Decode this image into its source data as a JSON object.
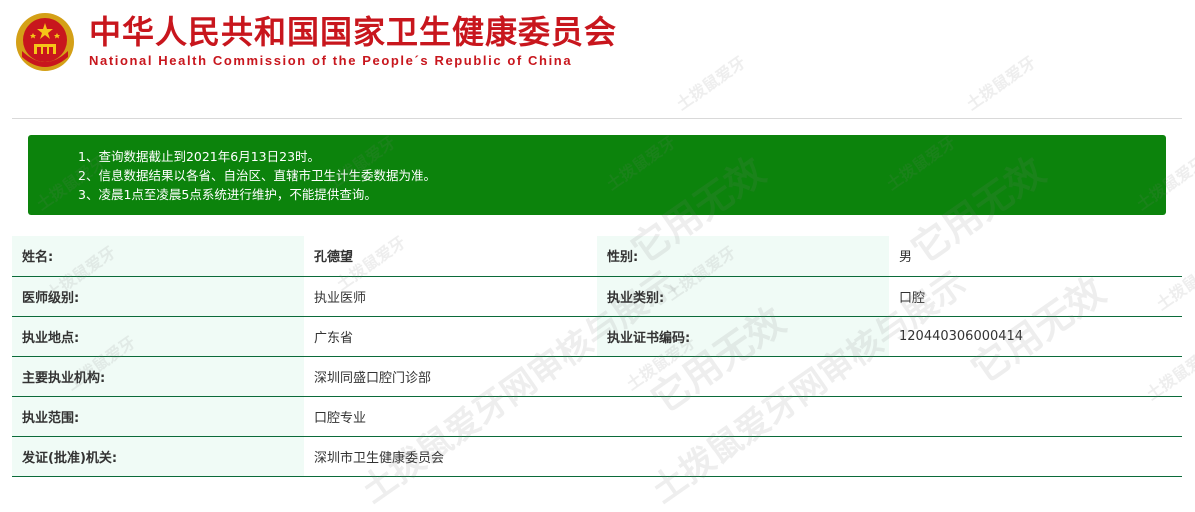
{
  "header": {
    "title_cn": "中华人民共和国国家卫生健康委员会",
    "title_en": "National Health Commission of the People´s Republic of China",
    "emblem_icon": "national-emblem-icon",
    "brand_color": "#c8161d"
  },
  "notice": {
    "background_color": "#0c830c",
    "lines": [
      "1、查询数据截止到2021年6月13日23时。",
      "2、信息数据结果以各省、自治区、直辖市卫生计生委数据为准。",
      "3、凌晨1点至凌晨5点系统进行维护，不能提供查询。"
    ]
  },
  "doctor": {
    "name_label": "姓名:",
    "name": "孔德望",
    "gender_label": "性别:",
    "gender": "男",
    "level_label": "医师级别:",
    "level": "执业医师",
    "category_label": "执业类别:",
    "category": "口腔",
    "location_label": "执业地点:",
    "location": "广东省",
    "cert_label": "执业证书编码:",
    "cert_number": "120440306000414",
    "org_label": "主要执业机构:",
    "org": "深圳同盛口腔门诊部",
    "scope_label": "执业范围:",
    "scope": "口腔专业",
    "issuer_label": "发证(批准)机关:",
    "issuer": "深圳市卫生健康委员会"
  },
  "watermarks": {
    "small": "土拨鼠爱牙",
    "large_a": "它用无效",
    "large_b": "土拨鼠爱牙网审核与展示"
  }
}
